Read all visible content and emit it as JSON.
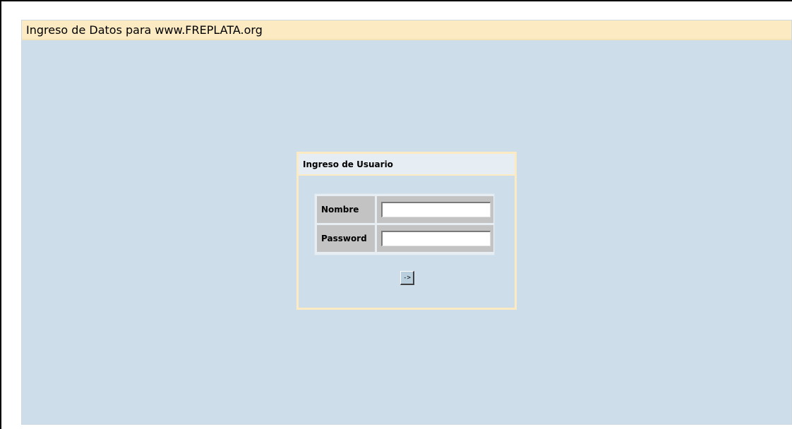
{
  "page": {
    "title": "Ingreso de Datos para www.FREPLATA.org"
  },
  "login": {
    "header": "Ingreso de Usuario",
    "fields": [
      {
        "label": "Nombre",
        "value": "",
        "placeholder": ""
      },
      {
        "label": "Password",
        "value": "",
        "placeholder": ""
      }
    ],
    "submit_label": "->"
  },
  "colors": {
    "page_background": "#cddeea",
    "title_bar": "#fcebc2",
    "panel_border": "#fcebc2",
    "label_cell": "#c3c3c3",
    "button": "#b9cfdd"
  }
}
